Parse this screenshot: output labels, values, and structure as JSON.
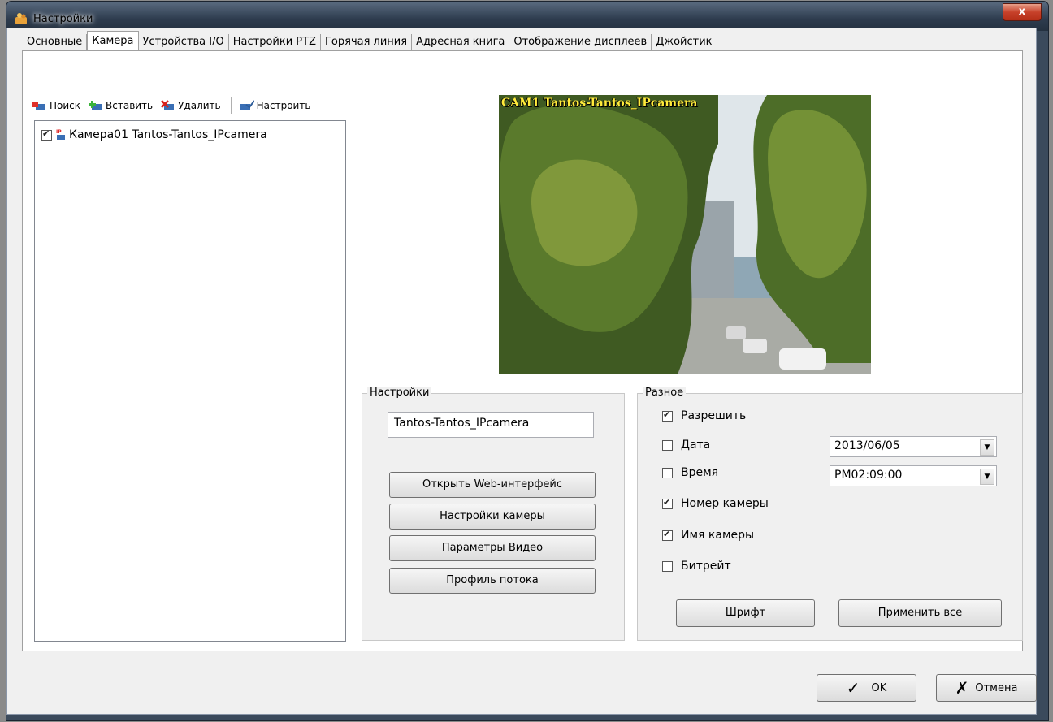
{
  "window": {
    "title": "Настройки",
    "close_glyph": "x"
  },
  "tabs": [
    {
      "label": "Основные"
    },
    {
      "label": "Камера"
    },
    {
      "label": "Устройства I/O"
    },
    {
      "label": "Настройки PTZ"
    },
    {
      "label": "Горячая линия"
    },
    {
      "label": "Адресная книга"
    },
    {
      "label": "Отображение дисплеев"
    },
    {
      "label": "Джойстик"
    }
  ],
  "active_tab": "Камера",
  "toolbar": {
    "search": "Поиск",
    "insert": "Вставить",
    "delete": "Удалить",
    "configure": "Настроить"
  },
  "camera_list": {
    "items": [
      {
        "label": "Камера01 Tantos-Tantos_IPcamera",
        "checked": true,
        "icon": "ip-camera-icon"
      }
    ]
  },
  "preview": {
    "overlay": "CAM1 Tantos-Tantos_IPcamera"
  },
  "settings_group": {
    "title": "Настройки",
    "name_value": "Tantos-Tantos_IPcamera",
    "buttons": {
      "web": "Открыть Web-интерфейс",
      "camera": "Настройки камеры",
      "video": "Параметры Видео",
      "stream": "Профиль потока"
    }
  },
  "misc_group": {
    "title": "Разное",
    "enable": {
      "label": "Разрешить",
      "checked": true
    },
    "date": {
      "label": "Дата",
      "checked": false,
      "value": "2013/06/05"
    },
    "time": {
      "label": "Время",
      "checked": false,
      "value": "PM02:09:00"
    },
    "cam_number": {
      "label": "Номер камеры",
      "checked": true
    },
    "cam_name": {
      "label": "Имя камеры",
      "checked": true
    },
    "bitrate": {
      "label": "Битрейт",
      "checked": false
    },
    "font_button": "Шрифт",
    "apply_all_button": "Применить все"
  },
  "footer": {
    "ok": "OK",
    "cancel": "Отмена"
  }
}
